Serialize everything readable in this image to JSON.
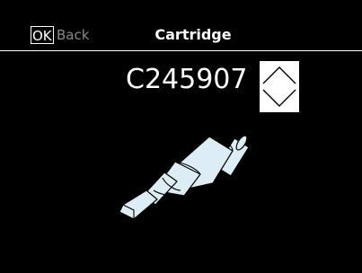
{
  "header": {
    "ok_key": "OK",
    "back_label": "Back",
    "title": "Cartridge"
  },
  "main": {
    "cartridge_code": "C245907",
    "stepper": {
      "up_icon": "chevron-up-icon",
      "down_icon": "chevron-down-icon"
    },
    "illustration_icon": "soldering-tip-cartridge-icon"
  },
  "colors": {
    "background": "#000000",
    "foreground": "#ffffff",
    "back_label": "#8a8a8a",
    "tip_fill": "#dcedf5"
  }
}
